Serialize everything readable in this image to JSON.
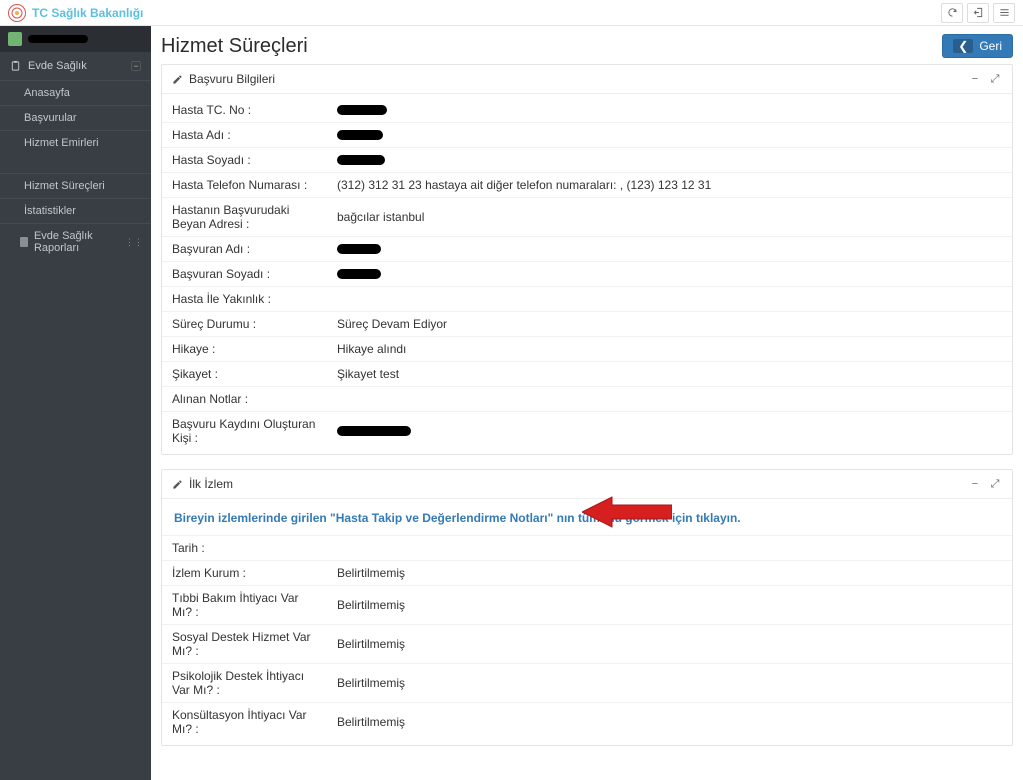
{
  "header": {
    "brand": "TC Sağlık Bakanlığı"
  },
  "sidebar": {
    "section_label": "Evde Sağlık",
    "items": [
      "Anasayfa",
      "Başvurular",
      "Hizmet Emirleri",
      "Hizmet Süreçleri",
      "İstatistikler",
      "Evde Sağlık Raporları"
    ]
  },
  "page": {
    "title": "Hizmet Süreçleri",
    "back_label": "Geri"
  },
  "panel1": {
    "title": "Başvuru Bilgileri",
    "rows": {
      "hasta_tc_lbl": "Hasta TC. No :",
      "hasta_adi_lbl": "Hasta Adı :",
      "hasta_soyadi_lbl": "Hasta Soyadı :",
      "tel_lbl": "Hasta Telefon Numarası :",
      "tel_val": "(312) 312 31 23 hastaya ait diğer telefon numaraları: , (123) 123 12 31",
      "adres_lbl": "Hastanın Başvurudaki Beyan Adresi :",
      "adres_val": "bağcılar istanbul",
      "basvuran_adi_lbl": "Başvuran Adı :",
      "basvuran_soyadi_lbl": "Başvuran Soyadı :",
      "yakinlik_lbl": "Hasta İle Yakınlık :",
      "surec_lbl": "Süreç Durumu :",
      "surec_val": "Süreç Devam Ediyor",
      "hikaye_lbl": "Hikaye :",
      "hikaye_val": "Hikaye alındı",
      "sikayet_lbl": "Şikayet :",
      "sikayet_val": "Şikayet test",
      "notlar_lbl": "Alınan Notlar :",
      "kisi_lbl": "Başvuru Kaydını Oluşturan Kişi :"
    }
  },
  "panel2": {
    "title": "İlk İzlem",
    "link": "Bireyin izlemlerinde girilen \"Hasta Takip ve Değerlendirme Notları\" nın tümünü görmek için tıklayın.",
    "rows": {
      "tarih_lbl": "Tarih :",
      "kurum_lbl": "İzlem Kurum :",
      "kurum_val": "Belirtilmemiş",
      "tibbi_lbl": "Tıbbi Bakım İhtiyacı Var Mı? :",
      "tibbi_val": "Belirtilmemiş",
      "sosyal_lbl": "Sosyal Destek Hizmet Var Mı? :",
      "sosyal_val": "Belirtilmemiş",
      "psiko_lbl": "Psikolojik Destek İhtiyacı Var Mı? :",
      "psiko_val": "Belirtilmemiş",
      "konsul_lbl": "Konsültasyon İhtiyacı Var Mı? :",
      "konsul_val": "Belirtilmemiş"
    }
  }
}
